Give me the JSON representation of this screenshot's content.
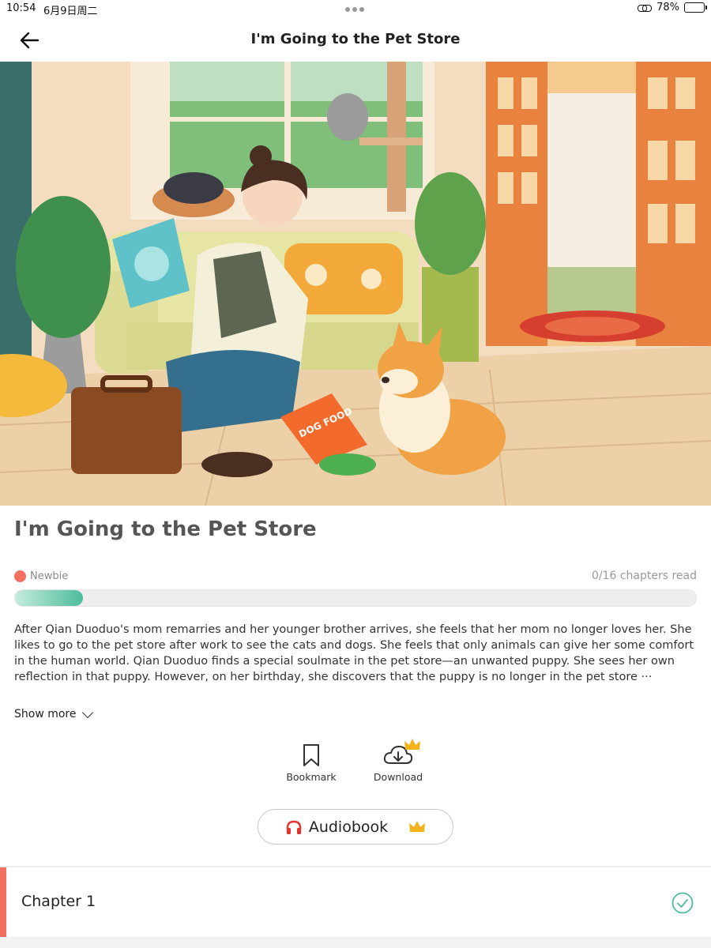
{
  "status_bar": {
    "time": "10:54",
    "date": "6月9日周二",
    "battery": "78%",
    "battery_level": 0.78
  },
  "header": {
    "title": "I'm Going to the Pet Store"
  },
  "cover": {
    "bag_text": "DOG FOOD"
  },
  "book": {
    "title": "I'm Going to the Pet Store",
    "level": "Newbie",
    "chapters_read": "0/16 chapters read",
    "progress": 0.1,
    "description": "After Qian Duoduo's mom remarries and her younger brother arrives, she feels that her mom no longer loves her. She likes to go to the pet store after work to see the cats and dogs. She feels that only animals can give her some comfort in the human world. Qian Duoduo finds a special soulmate in the pet store—an unwanted puppy. She sees her own reflection in that puppy. However, on her birthday, she discovers that the puppy is no longer in the pet store ···",
    "show_more": "Show more"
  },
  "actions": {
    "bookmark": "Bookmark",
    "download": "Download",
    "audiobook": "Audiobook"
  },
  "chapters": [
    {
      "title": "Chapter 1",
      "completed": true
    }
  ],
  "colors": {
    "accent": "#f36f61",
    "progress": "#4dbd9c",
    "crown": "#f5b21b",
    "headphones": "#e3342f"
  }
}
